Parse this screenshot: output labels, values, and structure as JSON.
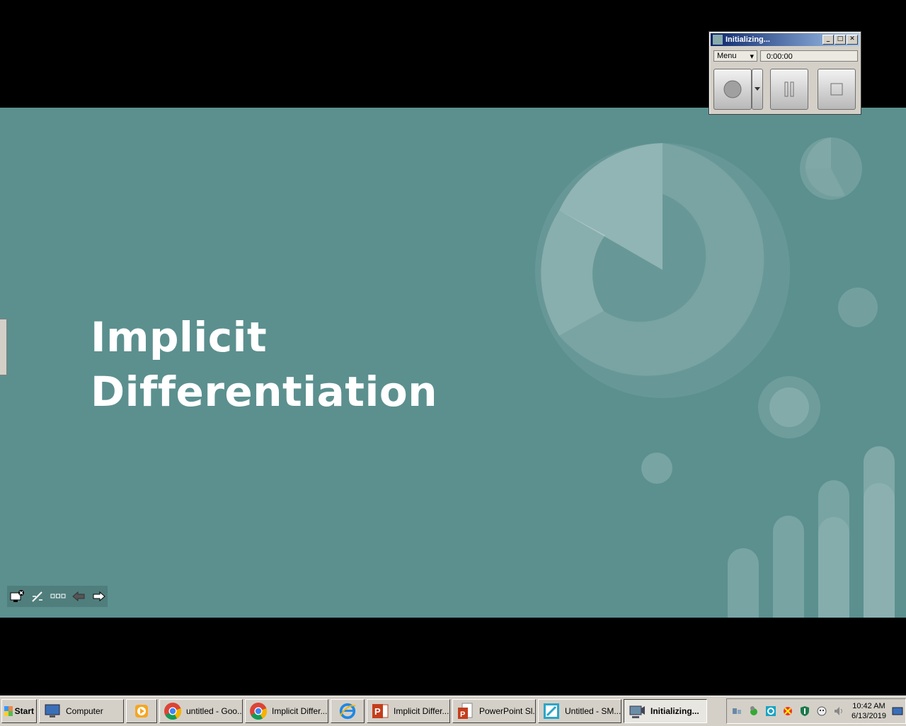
{
  "slide": {
    "title_line1": "Implicit",
    "title_line2": "Differentiation",
    "background_color": "#5b908f"
  },
  "recorder": {
    "window_title": "Initializing...",
    "menu_label": "Menu",
    "timer": "0:00:00",
    "buttons": [
      "record-icon",
      "dropdown-arrow-icon",
      "pause-icon",
      "stop-icon"
    ]
  },
  "taskbar": {
    "start_label": "Start",
    "items": [
      {
        "label": "Computer",
        "icon": "computer-icon"
      },
      {
        "label": "",
        "icon": "media-player-icon"
      },
      {
        "label": "untitled - Goo...",
        "icon": "chrome-icon"
      },
      {
        "label": "Implicit Differ...",
        "icon": "chrome-icon"
      },
      {
        "label": "",
        "icon": "internet-explorer-icon"
      },
      {
        "label": "Implicit Differ...",
        "icon": "powerpoint-icon"
      },
      {
        "label": "PowerPoint Sl...",
        "icon": "powerpoint-slideshow-icon"
      },
      {
        "label": "Untitled - SM...",
        "icon": "notebook-icon"
      },
      {
        "label": "Initializing...",
        "icon": "recorder-icon",
        "active": true
      }
    ],
    "clock_time": "10:42 AM",
    "clock_date": "6/13/2019"
  }
}
